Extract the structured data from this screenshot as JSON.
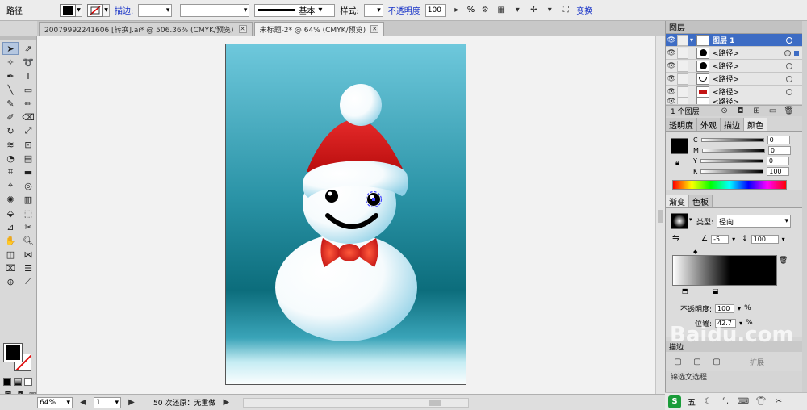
{
  "control_bar": {
    "object_type": "路径",
    "stroke_label": "描边:",
    "stroke_weight": "",
    "brush_profile": "基本",
    "style_label": "样式:",
    "opacity_label": "不透明度",
    "opacity_value": "100",
    "opacity_unit": "%",
    "transform_link": "变换"
  },
  "tabs": [
    {
      "label": "20079992241606 [转换].ai* @ 506.36% (CMYK/预览)"
    },
    {
      "label": "未标题-2* @ 64% (CMYK/预览)"
    }
  ],
  "status_bar": {
    "zoom": "64%",
    "artboard_no": "1",
    "undo_text": "50 次还原：无重做"
  },
  "layers_panel": {
    "title": "图层",
    "layer_name": "图层 1",
    "sublayers": [
      "<路径>",
      "<路径>",
      "<路径>",
      "<路径>",
      "<路径>"
    ],
    "footer": "1 个图层"
  },
  "color_panel": {
    "tabs": [
      "透明度",
      "外观",
      "描边",
      "颜色"
    ],
    "channels": [
      {
        "label": "C",
        "value": "0"
      },
      {
        "label": "M",
        "value": "0"
      },
      {
        "label": "Y",
        "value": "0"
      },
      {
        "label": "K",
        "value": "100"
      }
    ]
  },
  "gradient_panel": {
    "tabs": [
      "渐变",
      "色板"
    ],
    "type_label": "类型:",
    "type_value": "径向",
    "angle_value": "-5",
    "aspect_value": "100",
    "opacity_label": "不透明度:",
    "opacity_value": "100",
    "position_label": "位置:",
    "position_value": "42.7",
    "percent": "%",
    "stroke_partial": "描边",
    "expand_btn": "扩展"
  },
  "taskbar": {
    "ime_label": "S",
    "ime_mode": "五",
    "partial_text": "锦选文选程"
  },
  "watermark": "Baidu.com",
  "colors": {
    "selection_blue": "#3d6cc4",
    "link_blue": "#1a35c8",
    "sky_top": "#6cc6da",
    "sky_mid": "#127a8a",
    "hat_red": "#d41414"
  }
}
